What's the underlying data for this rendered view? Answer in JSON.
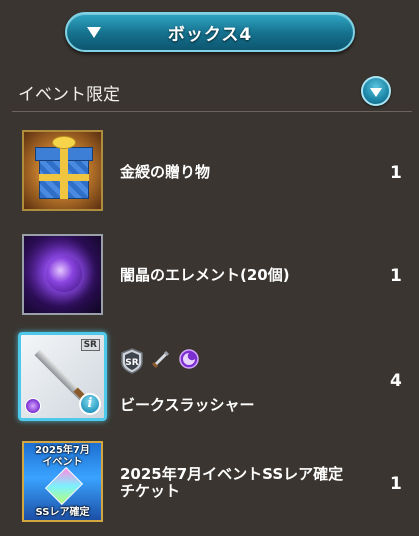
{
  "box_selector": {
    "label": "ボックス4"
  },
  "section": {
    "title": "イベント限定"
  },
  "items": [
    {
      "name": "金綬の贈り物",
      "count": "1",
      "thumb_icon": "gift-box-icon"
    },
    {
      "name": "闇晶のエレメント(20個)",
      "count": "1",
      "thumb_icon": "dark-element-icon"
    },
    {
      "name": "ビークスラッシャー",
      "count": "4",
      "thumb_icon": "sword-icon",
      "rarity": "SR",
      "weapon_type": "sword",
      "element": "dark"
    },
    {
      "name": "2025年7月イベントSSレア確定\nチケット",
      "count": "1",
      "thumb_icon": "ticket-icon",
      "thumb_text_top": "2025年7月\nイベント",
      "thumb_text_bottom": "SSレア確定"
    }
  ],
  "colors": {
    "accent": "#1d86a8",
    "background": "#3a3530",
    "dark_element": "#7b2fd1",
    "frame_gold": "#b08d3c"
  }
}
